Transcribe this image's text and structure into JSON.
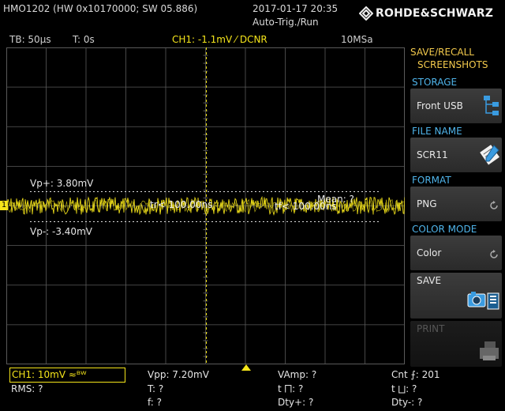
{
  "header": {
    "device": "HMO1202 (HW 0x10170000; SW 05.886)",
    "datetime": "2017-01-17 20:35",
    "trigger_state": "Auto-Trig./Run",
    "brand": "ROHDE&SCHWARZ"
  },
  "status_bar": {
    "timebase": "TB: 50µs",
    "time_offset": "T: 0s",
    "channel_trigger": "CH1: -1.1mV ⁄ DCNR",
    "sample_rate": "10MSa"
  },
  "screen": {
    "ch1_marker": "1",
    "vp_plus": "Vp+: 3.80mV",
    "vp_minus": "Vp-: -3.40mV",
    "mean": "Mean: ?",
    "tr": "tr< 100.00ns",
    "tf": "tf< 100.00ns",
    "colors": {
      "trace": "#f5e51a",
      "grid": "#5a5a5a"
    }
  },
  "softkeys": {
    "title": "SAVE/RECALL SCREENSHOTS",
    "title_line1": "SAVE/RECALL",
    "title_line2": "SCREENSHOTS",
    "storage_label": "STORAGE",
    "storage_value": "Front USB",
    "file_name_label": "FILE NAME",
    "file_name_value": "SCR11",
    "format_label": "FORMAT",
    "format_value": "PNG",
    "color_mode_label": "COLOR MODE",
    "color_mode_value": "Color",
    "save_label": "SAVE",
    "print_label": "PRINT"
  },
  "measurements": {
    "ch1_setting": "CH1: 10mV ≈ᴮᵂ",
    "vpp": "Vpp: 7.20mV",
    "vamp": "VAmp: ?",
    "cnt": "Cnt ⨍: 201",
    "rms": "RMS: ?",
    "period": "T: ?",
    "t_pos_pulse": "t ⨅: ?",
    "t_neg_pulse": "t ⨆: ?",
    "freq": "f: ?",
    "dty_plus": "Dty+: ?",
    "dty_minus": "Dty-: ?"
  }
}
